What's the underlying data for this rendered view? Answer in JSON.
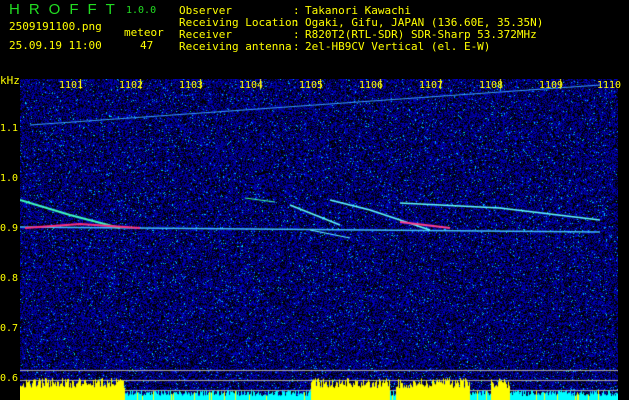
{
  "app": {
    "title": "HROFFT",
    "version": "1.0.0"
  },
  "file": {
    "name": "2509191100.png",
    "datetime": "25.09.19 11:00"
  },
  "meteor": {
    "label": "meteor",
    "count": "47"
  },
  "info": [
    {
      "label": "Observer",
      "value": "Takanori Kawachi"
    },
    {
      "label": "Receiving Location",
      "value": "Ogaki, Gifu, JAPAN (136.60E, 35.35N)"
    },
    {
      "label": "Receiver",
      "value": "R820T2(RTL-SDR) SDR-Sharp 53.372MHz"
    },
    {
      "label": "Receiving antenna",
      "value": "2el-HB9CV Vertical (el. E-W)"
    }
  ],
  "axis": {
    "y_unit": "kHz",
    "y_ticks": [
      "1.1",
      "1.0",
      "0.9",
      "0.8",
      "0.7",
      "0.6"
    ],
    "x_ticks": [
      "1101",
      "1102",
      "1103",
      "1104",
      "1105",
      "1106",
      "1107",
      "1108",
      "1109",
      "1110"
    ]
  },
  "colors": {
    "text": "#ffff00",
    "title": "#22dd22",
    "bg": "#000000",
    "noise": "#0a1acc",
    "bar_high": "#ffff00",
    "bar_low": "#00ffff"
  }
}
